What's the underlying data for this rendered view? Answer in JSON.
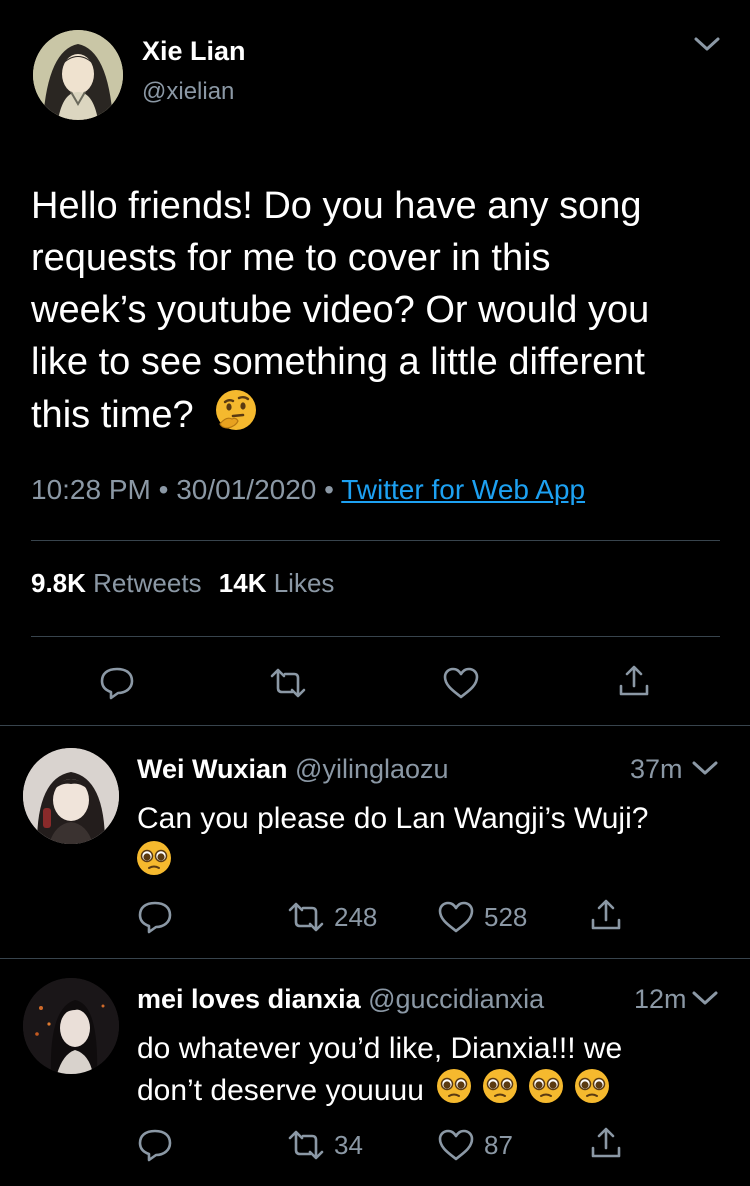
{
  "main_tweet": {
    "name": "Xie Lian",
    "handle": "@xielian",
    "text": "Hello friends! Do you have any song requests for me to cover in this week’s youtube video? Or would you like to see something a little different this time?",
    "text_lines": [
      "Hello friends! Do you have any song",
      "requests for me to cover in this",
      "week’s youtube video? Or would you",
      "like to see something a little different",
      "this time?"
    ],
    "emoji": "thinking-face",
    "time": "10:28 PM",
    "date": "30/01/2020",
    "source": "Twitter for Web App",
    "retweets_count": "9.8K",
    "retweets_label": "Retweets",
    "likes_count": "14K",
    "likes_label": "Likes"
  },
  "replies": [
    {
      "name": "Wei Wuxian",
      "handle": "@yilinglaozu",
      "age": "37m",
      "text": "Can you please do Lan Wangji’s Wuji?",
      "emoji": "pleading-face",
      "retweets": "248",
      "likes": "528"
    },
    {
      "name": "mei loves dianxia",
      "handle": "@guccidianxia",
      "age": "12m",
      "text_line1": "do whatever you’d like, Dianxia!!! we",
      "text_line2": "don’t deserve youuuu",
      "emoji": "pleading-face",
      "retweets": "34",
      "likes": "87"
    }
  ],
  "colors": {
    "background": "#000000",
    "text": "#ffffff",
    "secondary": "#8b98a5",
    "link": "#1da1f2",
    "divider": "#38444d",
    "emoji": "#f5b92e"
  }
}
